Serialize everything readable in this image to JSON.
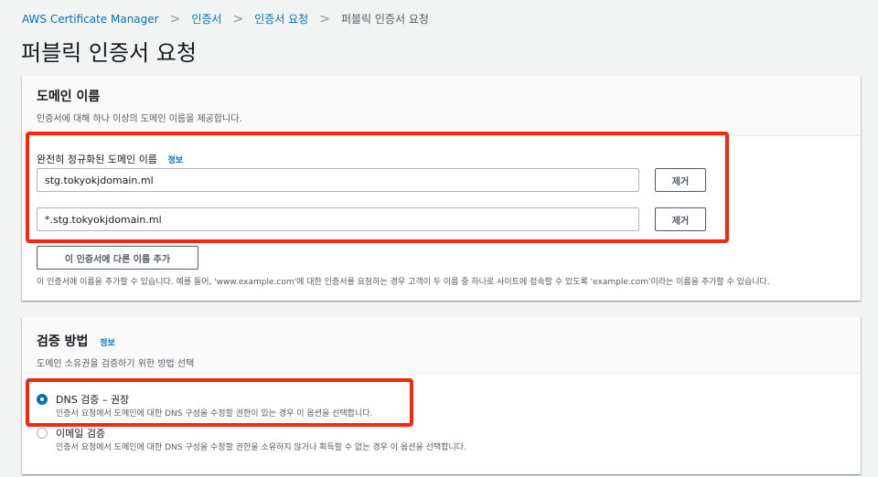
{
  "breadcrumb": {
    "items": [
      "AWS Certificate Manager",
      "인증서",
      "인증서 요청"
    ],
    "current": "퍼블릭 인증서 요청",
    "separator": ">"
  },
  "page": {
    "title": "퍼블릭 인증서 요청"
  },
  "domain_section": {
    "title": "도메인 이름",
    "description": "인증서에 대해 하나 이상의 도메인 이름을 제공합니다.",
    "field_label": "완전히 정규화된 도메인 이름",
    "info_label": "정보",
    "domains": [
      {
        "value": "stg.tokyokjdomain.ml",
        "remove_label": "제거"
      },
      {
        "value": "*.stg.tokyokjdomain.ml",
        "remove_label": "제거"
      }
    ],
    "add_button_label": "이 인증서에 다른 이름 추가",
    "hint": "이 인증서에 이름을 추가할 수 있습니다. 예를 들어, 'www.example.com'에 대한 인증서를 요청하는 경우 고객이 두 이름 중 하나로 사이트에 접속할 수 있도록 'example.com'이라는 이름을 추가할 수 있습니다."
  },
  "validation_section": {
    "title": "검증 방법",
    "info_label": "정보",
    "description": "도메인 소유권을 검증하기 위한 방법 선택",
    "options": [
      {
        "title": "DNS 검증 – 권장",
        "description": "인증서 요청에서 도메인에 대한 DNS 구성을 수정할 권한이 있는 경우 이 옵션을 선택합니다.",
        "selected": true
      },
      {
        "title": "이메일 검증",
        "description": "인증서 요청에서 도메인에 대한 DNS 구성을 수정할 권한을 소유하지 않거나 획득할 수 없는 경우 이 옵션을 선택합니다.",
        "selected": false
      }
    ]
  },
  "colors": {
    "link": "#0073bb",
    "highlight": "#f7270b",
    "background": "#f2f3f3"
  }
}
